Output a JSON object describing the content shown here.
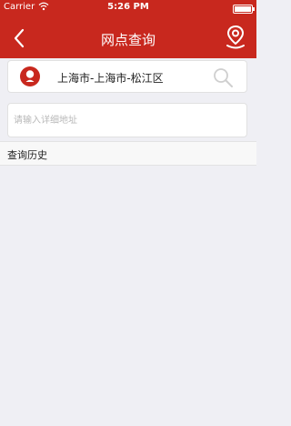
{
  "status_bar": {
    "carrier": "Carrier",
    "time": "5:26 PM",
    "battery_level": 1.0
  },
  "nav": {
    "title": "网点查询",
    "back_icon": "chevron-left-icon",
    "location_icon": "location-pin-icon"
  },
  "region_selector": {
    "text": "上海市-上海市-松江区",
    "pin_icon": "map-pin-icon",
    "search_icon": "search-icon"
  },
  "address_input": {
    "value": "",
    "placeholder": "请输入详细地址"
  },
  "history": {
    "label": "查询历史"
  },
  "colors": {
    "brand_red": "#c8281e",
    "background": "#efeff4"
  }
}
